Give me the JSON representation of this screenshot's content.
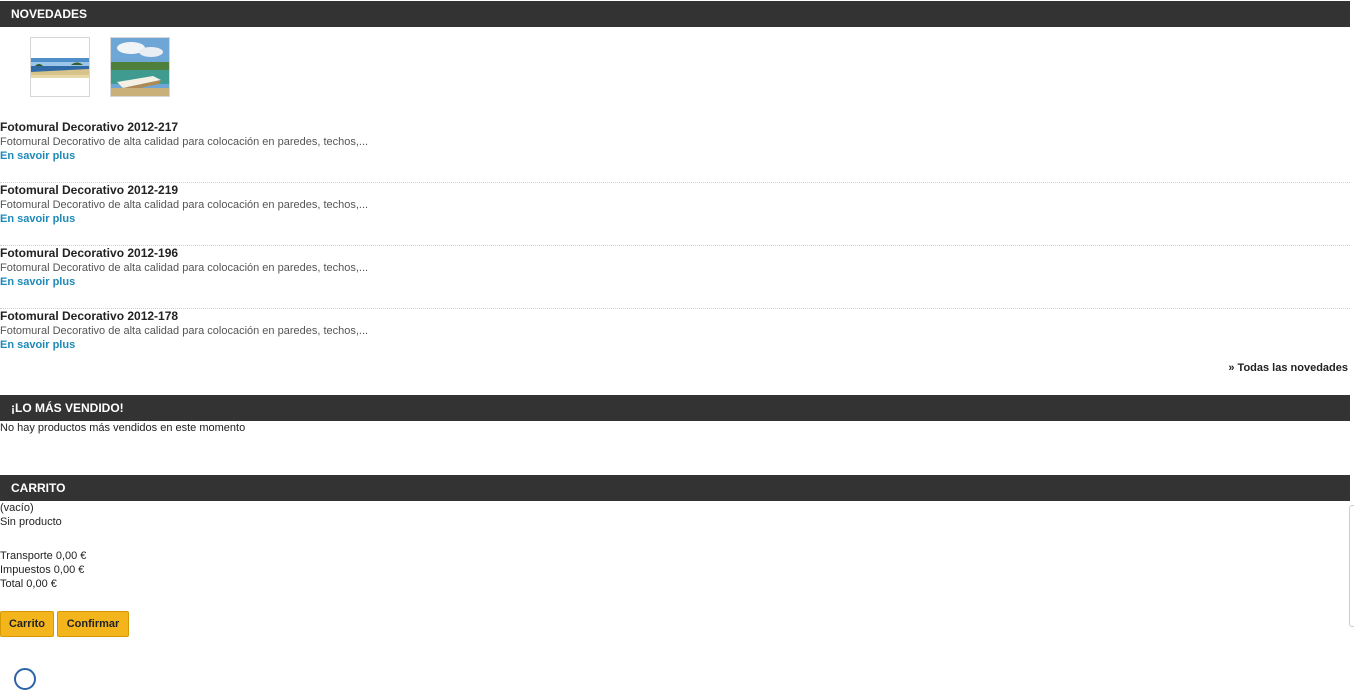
{
  "novedades": {
    "title": "NOVEDADES",
    "thumbnails": [
      {
        "name": "beach-panorama-image"
      },
      {
        "name": "boat-lagoon-image"
      }
    ],
    "products": [
      {
        "title": "Fotomural Decorativo 2012-217",
        "desc": "Fotomural Decorativo de alta calidad para colocación en paredes, techos,...",
        "more": "En savoir plus"
      },
      {
        "title": "Fotomural Decorativo 2012-219",
        "desc": "Fotomural Decorativo de alta calidad para colocación en paredes, techos,...",
        "more": "En savoir plus"
      },
      {
        "title": "Fotomural Decorativo 2012-196",
        "desc": "Fotomural Decorativo de alta calidad para colocación en paredes, techos,...",
        "more": "En savoir plus"
      },
      {
        "title": "Fotomural Decorativo 2012-178",
        "desc": "Fotomural Decorativo de alta calidad para colocación en paredes, techos,...",
        "more": "En savoir plus"
      }
    ],
    "all_link": "» Todas las novedades"
  },
  "vendido": {
    "title": "¡LO MÁS VENDIDO!",
    "empty_text": "No hay productos más vendidos en este momento"
  },
  "carrito": {
    "title": "CARRITO",
    "status": "(vacío)",
    "no_product": "Sin producto",
    "transport": "Transporte 0,00 €",
    "taxes": "Impuestos 0,00 €",
    "total": "Total 0,00 €",
    "btn_carrito": "Carrito",
    "btn_confirmar": "Confirmar"
  },
  "colors": {
    "header_bg": "#333333",
    "link": "#1d8ab8",
    "button": "#f4b51c"
  }
}
